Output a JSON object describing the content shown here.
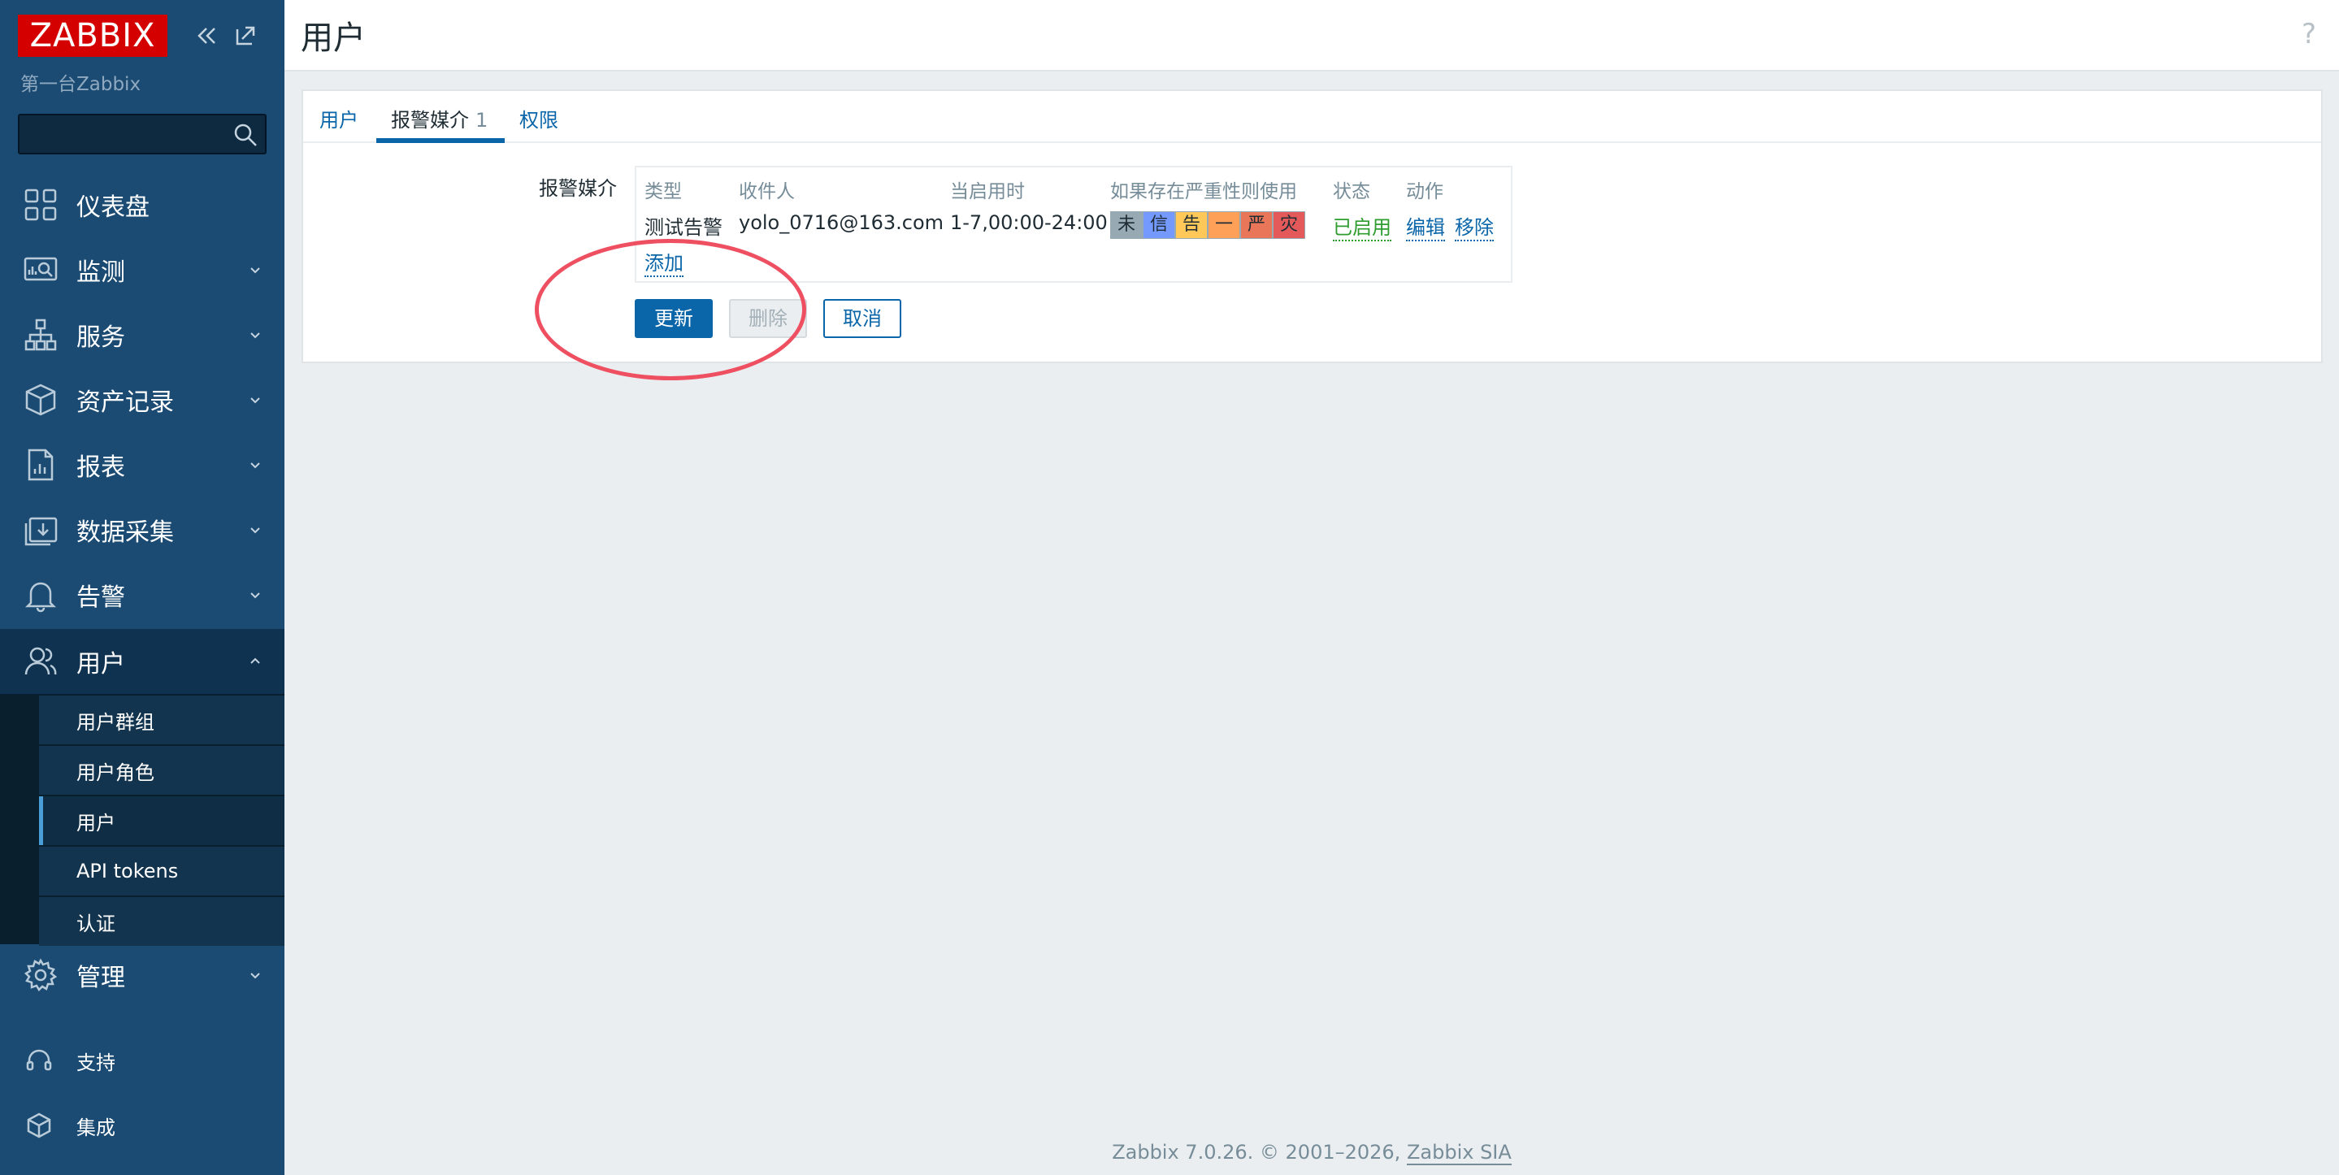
{
  "sidebar": {
    "logo": "ZABBIX",
    "server_name": "第一台Zabbix",
    "search_placeholder": "",
    "nav": [
      {
        "label": "仪表盘",
        "icon": "dashboard-icon"
      },
      {
        "label": "监测",
        "icon": "monitoring-icon"
      },
      {
        "label": "服务",
        "icon": "services-icon"
      },
      {
        "label": "资产记录",
        "icon": "inventory-icon"
      },
      {
        "label": "报表",
        "icon": "reports-icon"
      },
      {
        "label": "数据采集",
        "icon": "data-collection-icon"
      },
      {
        "label": "告警",
        "icon": "alerts-icon"
      },
      {
        "label": "用户",
        "icon": "users-icon"
      }
    ],
    "users_submenu": [
      {
        "label": "用户群组"
      },
      {
        "label": "用户角色"
      },
      {
        "label": "用户"
      },
      {
        "label": "API tokens"
      },
      {
        "label": "认证"
      }
    ],
    "admin": {
      "label": "管理",
      "icon": "settings-icon"
    },
    "bottom": [
      {
        "label": "支持",
        "icon": "headset-icon"
      },
      {
        "label": "集成",
        "icon": "integrations-icon"
      }
    ]
  },
  "header": {
    "title": "用户",
    "help": "?"
  },
  "tabs": [
    {
      "label": "用户"
    },
    {
      "label": "报警媒介",
      "count": "1"
    },
    {
      "label": "权限"
    }
  ],
  "media": {
    "field_label": "报警媒介",
    "columns": [
      "类型",
      "收件人",
      "当启用时",
      "如果存在严重性则使用",
      "状态",
      "动作"
    ],
    "rows": [
      {
        "type": "测试告警",
        "recipient": "yolo_0716@163.com",
        "when_active": "1-7,00:00-24:00",
        "severities": [
          {
            "label": "未",
            "color": "#97aab3"
          },
          {
            "label": "信",
            "color": "#7499ff"
          },
          {
            "label": "告",
            "color": "#ffc859"
          },
          {
            "label": "一",
            "color": "#ffa059"
          },
          {
            "label": "严",
            "color": "#e97659"
          },
          {
            "label": "灾",
            "color": "#e45959"
          }
        ],
        "status": "已启用",
        "actions": [
          "编辑",
          "移除"
        ]
      }
    ],
    "add_link": "添加"
  },
  "buttons": {
    "update": "更新",
    "delete": "删除",
    "cancel": "取消"
  },
  "footer": {
    "text": "Zabbix 7.0.26. © 2001–2026, ",
    "link": "Zabbix SIA"
  },
  "colors": {
    "sidebar": "#1b4b73",
    "accent": "#0a66a8",
    "logo": "#d40000",
    "annotation": "#ee4f61",
    "enabled": "#2e9c2e"
  }
}
